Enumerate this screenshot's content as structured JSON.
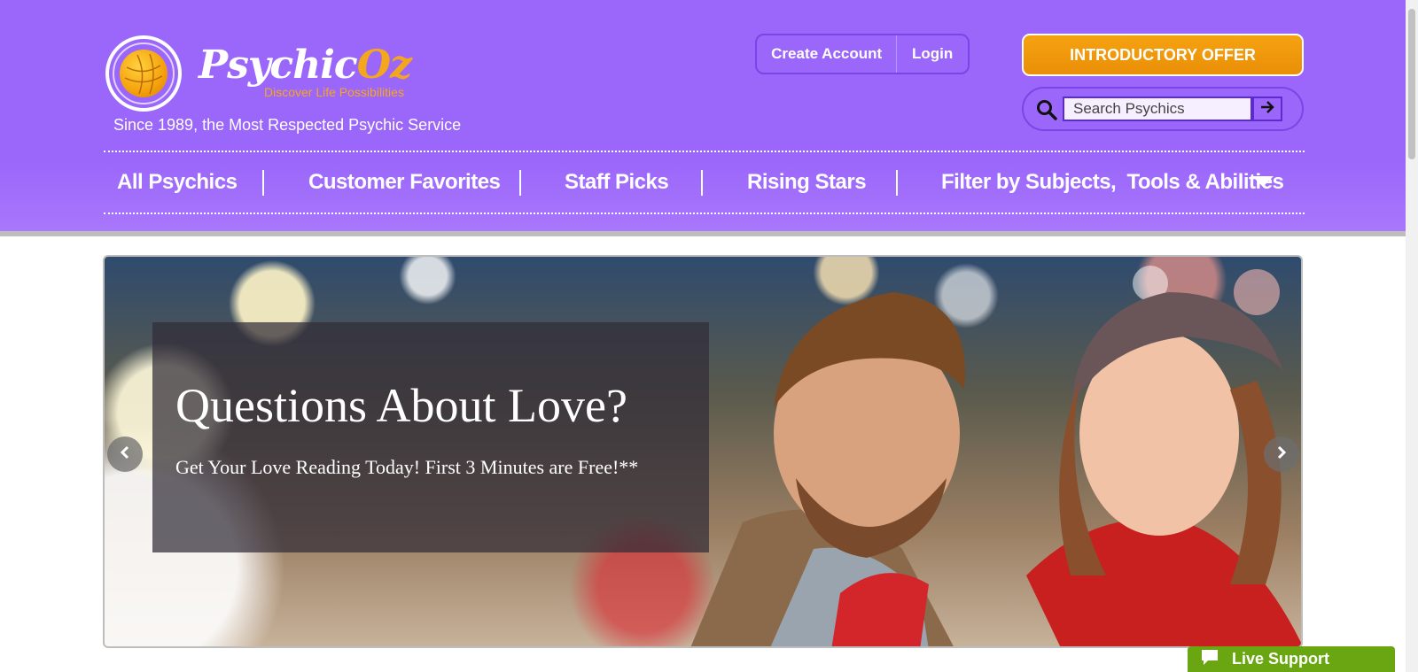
{
  "brand": {
    "name_main": "Psychic",
    "name_accent": "Oz",
    "tagline": "Discover Life Possibilities",
    "since": "Since 1989, the Most Respected Psychic Service",
    "colors": {
      "header_purple": "#9b67fb",
      "accent_orange": "#f5a71c",
      "offer_orange": "#ef9a0c",
      "live_support_green": "#6aa612"
    }
  },
  "account": {
    "create_label": "Create Account",
    "login_label": "Login"
  },
  "offer": {
    "label": "INTRODUCTORY OFFER"
  },
  "search": {
    "placeholder": "Search Psychics",
    "icon": "search-icon",
    "submit_icon": "arrow-right-icon"
  },
  "nav": {
    "items": [
      {
        "label": "All Psychics"
      },
      {
        "label": "Customer Favorites"
      },
      {
        "label": "Staff Picks"
      },
      {
        "label": "Rising Stars"
      },
      {
        "label": "Filter by Subjects,  Tools & Abilities"
      }
    ],
    "dropdown_icon": "caret-down-icon"
  },
  "hero": {
    "title": "Questions About Love?",
    "subtitle": "Get Your Love Reading Today! First 3 Minutes are Free!**",
    "prev_icon": "chevron-left-icon",
    "next_icon": "chevron-right-icon"
  },
  "live_support": {
    "label": "Live Support",
    "icon": "chat-bubble-icon"
  }
}
